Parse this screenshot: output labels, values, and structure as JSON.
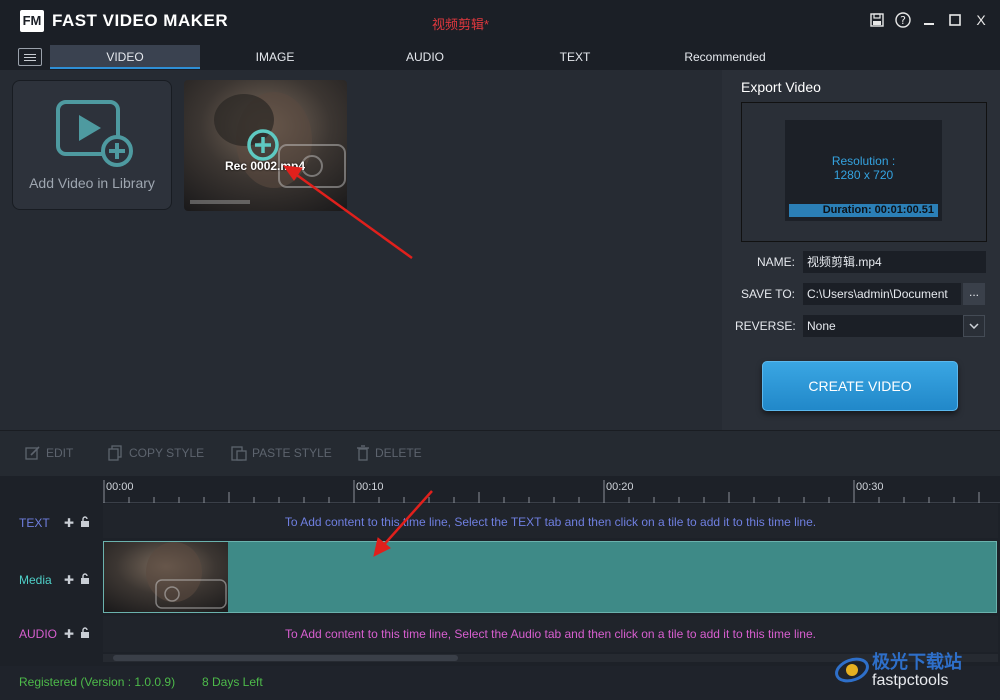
{
  "app": {
    "logo": "FM",
    "title": "FAST VIDEO MAKER",
    "project": "视频剪辑*",
    "icons": [
      "save-icon",
      "help-icon",
      "minimize-icon",
      "maximize-icon",
      "close-icon"
    ],
    "close_label": "X"
  },
  "tabs": [
    {
      "label": "VIDEO",
      "active": true
    },
    {
      "label": "IMAGE",
      "active": false
    },
    {
      "label": "AUDIO",
      "active": false
    },
    {
      "label": "TEXT",
      "active": false
    },
    {
      "label": "Recommended",
      "active": false
    }
  ],
  "library": {
    "add_label": "Add Video in Library",
    "video_name": "Rec 0002.mp4"
  },
  "export": {
    "title": "Export Video",
    "resolution_label": "Resolution :",
    "resolution_value": "1280 x 720",
    "duration": "Duration: 00:01:00.51",
    "name_label": "NAME:",
    "name_value": "视频剪辑.mp4",
    "save_label": "SAVE TO:",
    "save_value": "C:\\Users\\admin\\Document",
    "browse_label": "...",
    "reverse_label": "REVERSE:",
    "reverse_value": "None",
    "create_label": "CREATE VIDEO"
  },
  "toolbar": {
    "edit": "EDIT",
    "copy_style": "COPY STYLE",
    "paste_style": "PASTE STYLE",
    "delete": "DELETE"
  },
  "timeline": {
    "ticks": [
      "00:00",
      "00:10",
      "00:20",
      "00:30"
    ],
    "text_track": "TEXT",
    "media_track": "Media",
    "audio_track": "AUDIO",
    "text_msg": "To Add content to this time line, Select the TEXT tab and then click on a tile to add it to this time line.",
    "audio_msg": "To Add content to this time line, Select the Audio tab and then click on a tile to add it to this time line."
  },
  "status": {
    "registered": "Registered (Version : 1.0.0.9)",
    "days_left": "8 Days Left"
  },
  "watermark": {
    "cn": "极光下载站",
    "en": "fastpctools"
  },
  "colors": {
    "accent": "#2e8fd6",
    "create_button": "#2188c9",
    "media_clip": "#3e8a87",
    "text_track": "#6f7fe0",
    "media_track": "#4fd0c8",
    "audio_track": "#d85fd0",
    "status_green": "#4dba4a",
    "project_red": "#e0383e",
    "annotation_arrow": "#e0201c"
  }
}
